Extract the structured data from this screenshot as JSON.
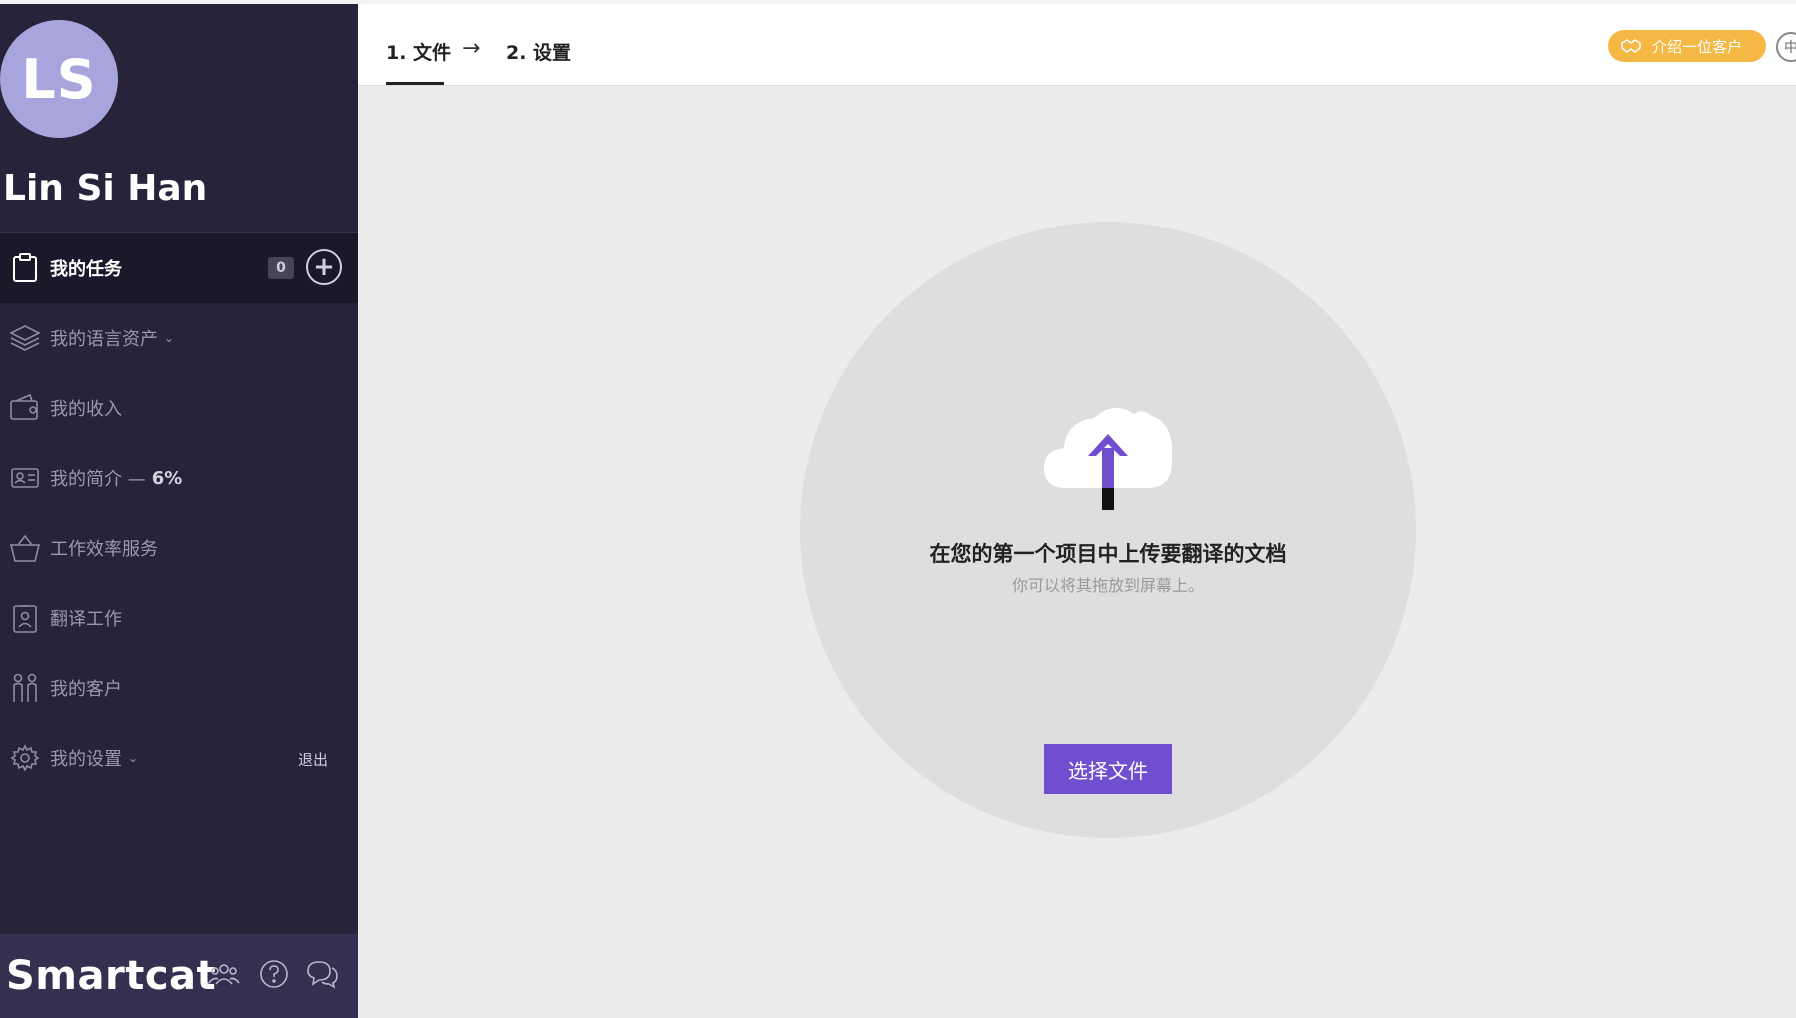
{
  "user": {
    "initials": "LS",
    "name": "Lin Si Han"
  },
  "sidebar": {
    "items": [
      {
        "label": "我的任务",
        "count": "0"
      },
      {
        "label": "我的语言资产"
      },
      {
        "label": "我的收入"
      },
      {
        "label": "我的简介 —",
        "suffix": "6%"
      },
      {
        "label": "工作效率服务"
      },
      {
        "label": "翻译工作"
      },
      {
        "label": "我的客户"
      },
      {
        "label": "我的设置",
        "logout": "退出"
      }
    ],
    "brand": "Smartcat"
  },
  "topbar": {
    "step1": "1. 文件",
    "step2": "2. 设置",
    "referral": "介绍一位客户",
    "lang": "中"
  },
  "upload": {
    "title": "在您的第一个项目中上传要翻译的文档",
    "subtitle": "你可以将其拖放到屏幕上。",
    "button": "选择文件"
  },
  "colors": {
    "sidebar_bg": "#26233a",
    "accent": "#6f4fcf",
    "referral": "#f5b845",
    "avatar": "#a8a5dc"
  }
}
